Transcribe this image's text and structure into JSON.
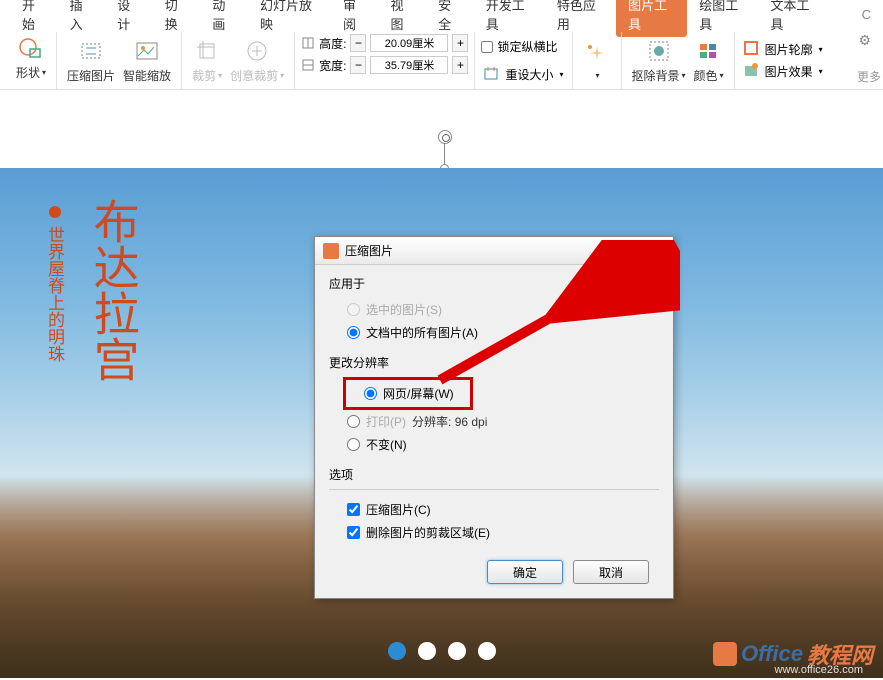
{
  "ribbon": {
    "tabs": [
      "开始",
      "插入",
      "设计",
      "切换",
      "动画",
      "幻灯片放映",
      "审阅",
      "视图",
      "安全",
      "开发工具",
      "特色应用",
      "图片工具",
      "绘图工具",
      "文本工具"
    ],
    "active_tab": "图片工具",
    "shape": "形状",
    "compress": "压缩图片",
    "smartscale": "智能缩放",
    "crop": "裁剪",
    "creative_crop": "创意裁剪",
    "height_label": "高度:",
    "width_label": "宽度:",
    "height_value": "20.09厘米",
    "width_value": "35.79厘米",
    "lock_ratio": "锁定纵横比",
    "reset_size": "重设大小",
    "remove_bg": "抠除背景",
    "color": "颜色",
    "pic_outline": "图片轮廓",
    "pic_effect": "图片效果",
    "more": "更多"
  },
  "slide": {
    "main_title": "布达拉宫",
    "sub_title": "世界屋脊上的明珠"
  },
  "dialog": {
    "title": "压缩图片",
    "apply_to": "应用于",
    "opt_selected": "选中的图片(S)",
    "opt_all": "文档中的所有图片(A)",
    "change_res": "更改分辨率",
    "opt_web": "网页/屏幕(W)",
    "opt_print": "打印(P)",
    "opt_nochange": "不变(N)",
    "res_label": "分辨率:",
    "res_value": "96 dpi",
    "options": "选项",
    "opt_compress": "压缩图片(C)",
    "opt_delcrop": "删除图片的剪裁区域(E)",
    "ok": "确定",
    "cancel": "取消"
  },
  "watermark": {
    "brand1": "Office",
    "brand2": "教程网",
    "url": "www.office26.com"
  }
}
